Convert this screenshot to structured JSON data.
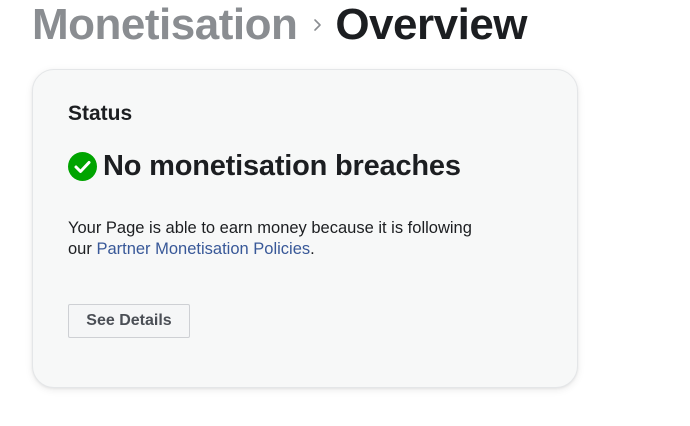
{
  "breadcrumb": {
    "parent": "Monetisation",
    "current": "Overview",
    "separator_icon": "chevron-right-icon"
  },
  "status_card": {
    "title": "Status",
    "status_icon": "check-circle-icon",
    "status_text": "No monetisation breaches",
    "description_prefix": "Your Page is able to earn money because it is following our ",
    "policy_link_text": "Partner Monetisation Policies",
    "description_suffix": ".",
    "button_label": "See Details"
  },
  "colors": {
    "success_green": "#00a400",
    "link_blue": "#385898",
    "muted_gray": "#8a8d91",
    "text_dark": "#1c1e21"
  }
}
